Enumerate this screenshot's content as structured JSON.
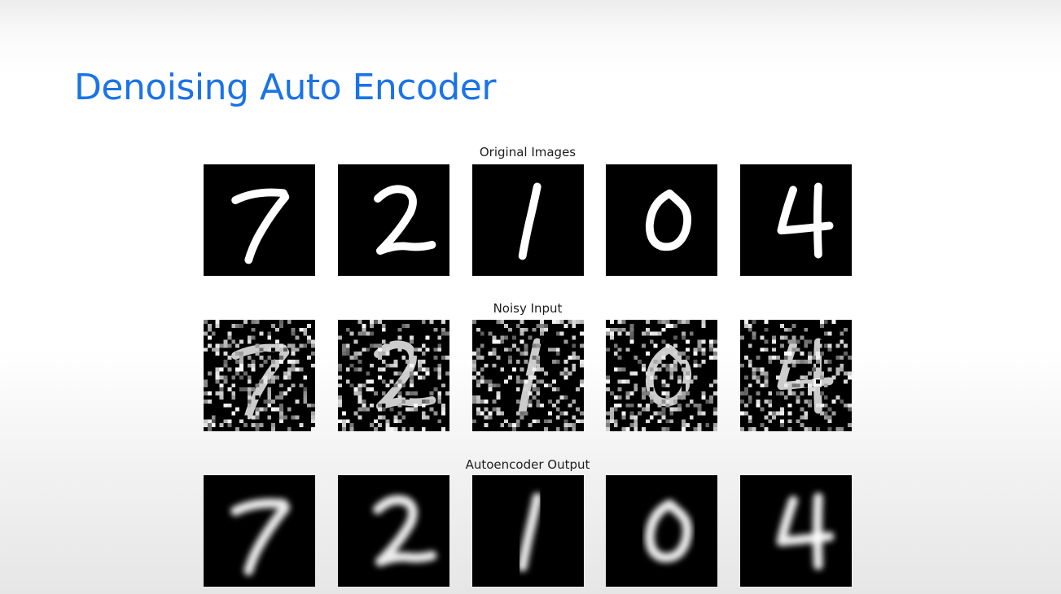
{
  "slide": {
    "title": "Denoising Auto Encoder"
  },
  "figure": {
    "rows": [
      {
        "label": "Original Images",
        "style": "clean",
        "digits": [
          "7",
          "2",
          "1",
          "0",
          "4"
        ]
      },
      {
        "label": "Noisy Input",
        "style": "noisy",
        "digits": [
          "7",
          "2",
          "1",
          "0",
          "4"
        ]
      },
      {
        "label": "Autoencoder Output",
        "style": "blurred",
        "digits": [
          "7",
          "2",
          "1",
          "0",
          "4"
        ]
      }
    ]
  },
  "colors": {
    "title": "#1a73e8",
    "tile_background": "#000000",
    "digit_stroke": "#ffffff"
  }
}
